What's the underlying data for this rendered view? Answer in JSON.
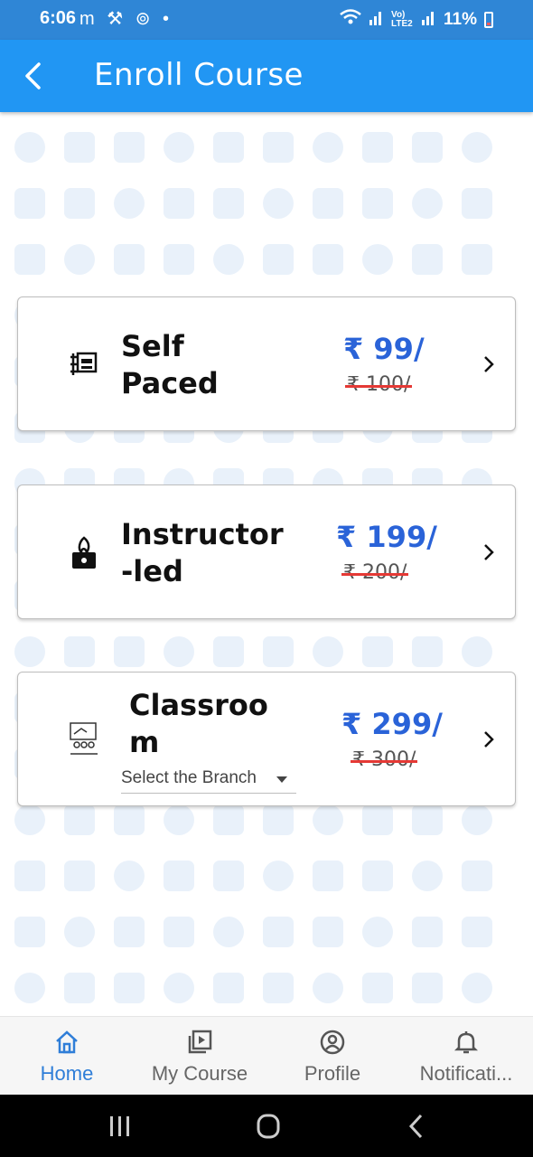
{
  "status_bar": {
    "time": "6:06",
    "left_icons": "m ⚒ ⊚ •",
    "right_text": "11%",
    "lte": "Vo) LTE2"
  },
  "app_bar": {
    "title": "Enroll Course",
    "back_icon": "back-arrow-icon"
  },
  "courses": [
    {
      "title_line1": "Self",
      "title_line2": "Paced",
      "price": "₹ 99/",
      "old_price": "₹ 100/",
      "icon": "self-paced-icon"
    },
    {
      "title_line1": "Instructor",
      "title_line2": "-led",
      "price": "₹ 199/",
      "old_price": "₹ 200/",
      "icon": "instructor-led-icon"
    },
    {
      "title_line1": "Classroo",
      "title_line2": "m",
      "price": "₹ 299/",
      "old_price": "₹ 300/",
      "icon": "classroom-icon",
      "branch_placeholder": "Select the Branch"
    }
  ],
  "bottom_nav": [
    {
      "label": "Home",
      "icon": "home-icon",
      "active": true
    },
    {
      "label": "My Course",
      "icon": "my-course-icon",
      "active": false
    },
    {
      "label": "Profile",
      "icon": "profile-icon",
      "active": false
    },
    {
      "label": "Notificati...",
      "icon": "bell-icon",
      "active": false
    }
  ],
  "colors": {
    "app_bar": "#2196f3",
    "status_bar": "#2f86d6",
    "price": "#2a63d8",
    "strike": "#e53935",
    "active_nav": "#2f7ed8"
  }
}
